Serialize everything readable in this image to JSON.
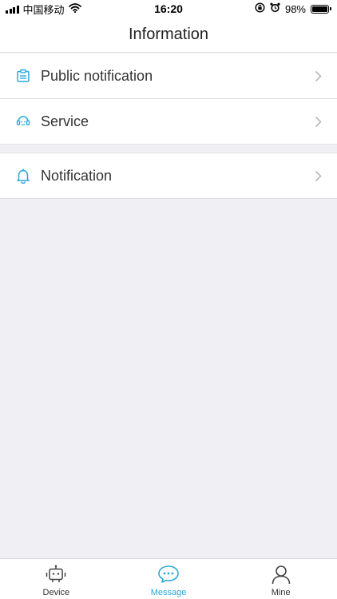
{
  "status_bar": {
    "carrier": "中国移动",
    "time": "16:20",
    "battery": "98%",
    "battery_level": 0.98,
    "icons": [
      "signal-icon",
      "wifi-icon",
      "orientation-lock-icon",
      "alarm-icon",
      "battery-icon"
    ]
  },
  "navbar": {
    "title": "Information"
  },
  "list": {
    "items": [
      {
        "label": "Public notification",
        "icon": "clipboard-icon"
      },
      {
        "label": "Service",
        "icon": "headset-icon"
      },
      {
        "label": "Notification",
        "icon": "bell-icon"
      }
    ]
  },
  "tabbar": {
    "tabs": [
      {
        "label": "Device",
        "icon": "robot-icon",
        "active": false
      },
      {
        "label": "Message",
        "icon": "chat-bubble-icon",
        "active": true
      },
      {
        "label": "Mine",
        "icon": "person-icon",
        "active": false
      }
    ]
  },
  "colors": {
    "accent": "#29a8d8",
    "background": "#efeff4",
    "divider": "#e1e1e6"
  }
}
